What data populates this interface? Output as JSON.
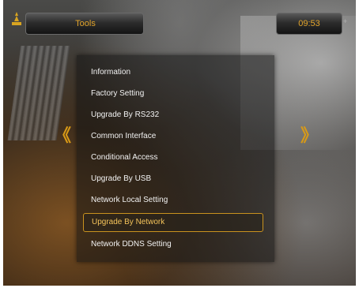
{
  "header": {
    "title": "Tools",
    "clock": "09:53",
    "clock_extra": "+"
  },
  "navigation": {
    "left_arrow": "《",
    "right_arrow": "》"
  },
  "menu": {
    "selected_index": 7,
    "items": [
      {
        "label": "Information"
      },
      {
        "label": "Factory Setting"
      },
      {
        "label": "Upgrade By RS232"
      },
      {
        "label": "Common Interface"
      },
      {
        "label": "Conditional Access"
      },
      {
        "label": "Upgrade By USB"
      },
      {
        "label": "Network Local Setting"
      },
      {
        "label": "Upgrade By Network"
      },
      {
        "label": "Network DDNS Setting"
      }
    ]
  },
  "colors": {
    "accent": "#e2a42a",
    "highlight_border": "#c9921e",
    "menu_text": "#f2f2f2"
  },
  "icons": {
    "logo": "antenna-logo-icon",
    "left": "double-chevron-left-icon",
    "right": "double-chevron-right-icon"
  }
}
